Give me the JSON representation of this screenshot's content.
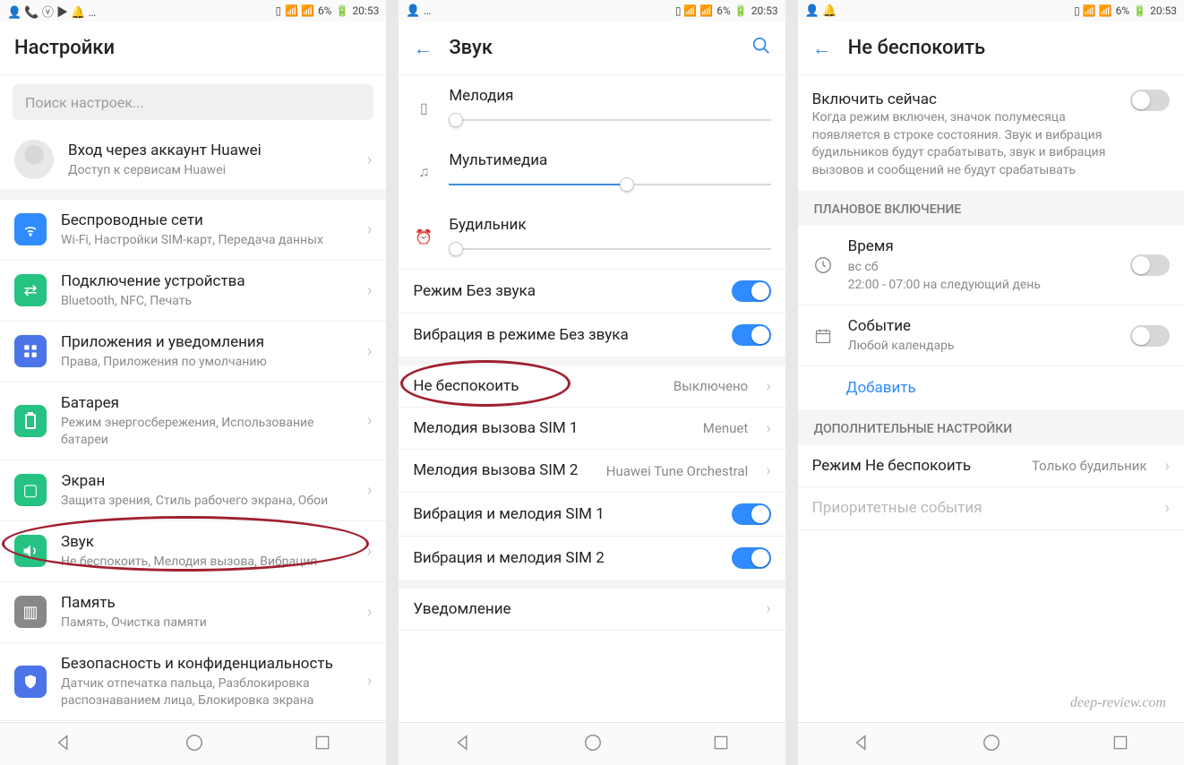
{
  "status": {
    "battery": "6%",
    "time": "20:53"
  },
  "s1": {
    "title": "Настройки",
    "search_placeholder": "Поиск настроек...",
    "account_t": "Вход через аккаунт Huawei",
    "account_s": "Доступ к сервисам Huawei",
    "wifi_t": "Беспроводные сети",
    "wifi_s": "Wi-Fi, Настройки SIM-карт, Передача данных",
    "conn_t": "Подключение устройства",
    "conn_s": "Bluetooth, NFC, Печать",
    "apps_t": "Приложения и уведомления",
    "apps_s": "Права, Приложения по умолчанию",
    "batt_t": "Батарея",
    "batt_s": "Режим энергосбережения, Использование батареи",
    "disp_t": "Экран",
    "disp_s": "Защита зрения, Стиль рабочего экрана, Обои",
    "sound_t": "Звук",
    "sound_s": "Не беспокоить, Мелодия вызова, Вибрация",
    "mem_t": "Память",
    "mem_s": "Память, Очистка памяти",
    "sec_t": "Безопасность и конфиденциальность",
    "sec_s": "Датчик отпечатка пальца, Разблокировка распознаванием лица, Блокировка экрана"
  },
  "s2": {
    "title": "Звук",
    "ring": "Мелодия",
    "media": "Мультимедиа",
    "alarm": "Будильник",
    "silent": "Режим Без звука",
    "vib": "Вибрация в режиме Без звука",
    "dnd": "Не беспокоить",
    "dnd_v": "Выключено",
    "sim1": "Мелодия вызова SIM 1",
    "sim1_v": "Menuet",
    "sim2": "Мелодия вызова SIM 2",
    "sim2_v": "Huawei Tune Orchestral",
    "vs1": "Вибрация и мелодия SIM 1",
    "vs2": "Вибрация и мелодия SIM 2",
    "notif": "Уведомление",
    "sliders": {
      "ring": 2,
      "media": 55,
      "alarm": 2
    }
  },
  "s3": {
    "title": "Не беспокоить",
    "now_t": "Включить сейчас",
    "now_d": "Когда режим включен, значок полумесяца появляется в строке состояния. Звук и вибрация будильников будут срабатывать, звук и вибрация вызовов и сообщений не будут срабатывать",
    "sched_hdr": "ПЛАНОВОЕ ВКЛЮЧЕНИЕ",
    "time_t": "Время",
    "time_s1": "вс сб",
    "time_s2": "22:00 - 07:00 на следующий день",
    "event_t": "Событие",
    "event_s": "Любой календарь",
    "add": "Добавить",
    "more_hdr": "ДОПОЛНИТЕЛЬНЫЕ НАСТРОЙКИ",
    "mode_t": "Режим Не беспокоить",
    "mode_v": "Только будильник",
    "prio": "Приоритетные события"
  },
  "watermark": "deep-review.com"
}
